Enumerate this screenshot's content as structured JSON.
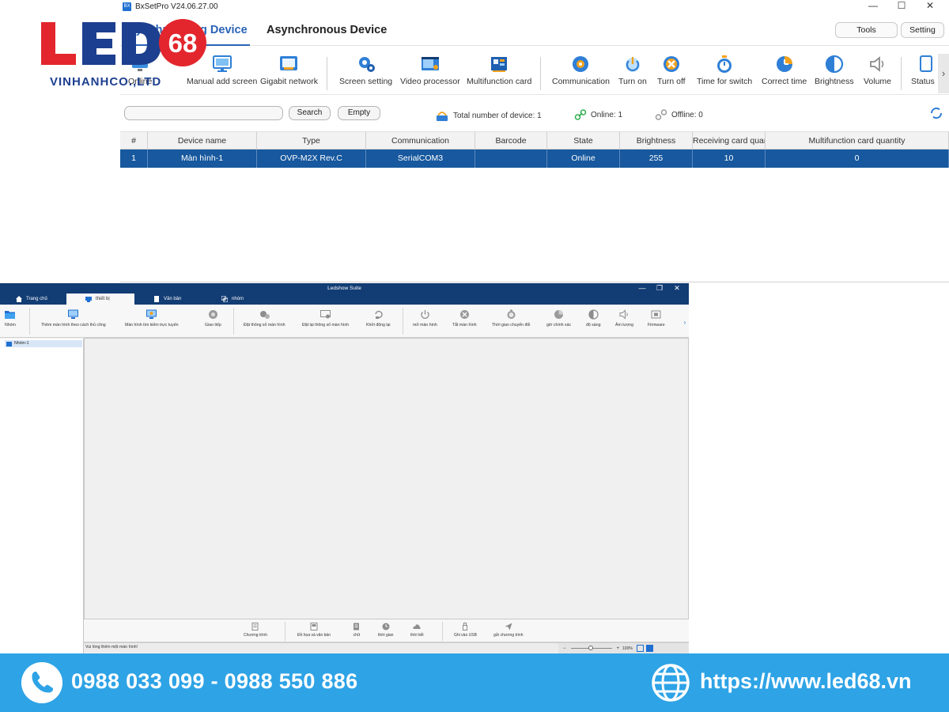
{
  "bxsetpro": {
    "window_title": "BxSetPro V24.06.27.00",
    "app_icon_text": "BX",
    "window_controls": [
      "—",
      "☐",
      "✕"
    ],
    "tabs": {
      "sync": "Synchronizing Device",
      "async": "Asynchronous Device"
    },
    "top_buttons": {
      "tools": "Tools",
      "setting": "Setting"
    },
    "toolbar": [
      {
        "label": "Online",
        "icon": "search-screen-icon"
      },
      {
        "label": "Manual add screen",
        "icon": "monitor-icon"
      },
      {
        "label": "Gigabit network",
        "icon": "network-card-icon"
      },
      {
        "label": "Screen setting",
        "icon": "gear-icon"
      },
      {
        "label": "Video processor",
        "icon": "video-processor-icon"
      },
      {
        "label": "Multifunction card",
        "icon": "circuit-card-icon"
      },
      {
        "label": "Communication",
        "icon": "communication-icon"
      },
      {
        "label": "Turn on",
        "icon": "power-icon"
      },
      {
        "label": "Turn off",
        "icon": "close-circle-icon"
      },
      {
        "label": "Time for switch",
        "icon": "timer-icon"
      },
      {
        "label": "Correct time",
        "icon": "clock-icon"
      },
      {
        "label": "Brightness",
        "icon": "brightness-icon"
      },
      {
        "label": "Volume",
        "icon": "volume-icon"
      },
      {
        "label": "Status",
        "icon": "status-icon"
      }
    ],
    "toolbar_more": "›",
    "search": {
      "value": "",
      "search_label": "Search",
      "empty_label": "Empty"
    },
    "stats": {
      "total": "Total number of device:  1",
      "online": "Online:  1",
      "offline": "Offline:  0"
    },
    "table": {
      "headers": [
        "#",
        "Device name",
        "Type",
        "Communication",
        "Barcode",
        "State",
        "Brightness",
        "Receiving card quantity",
        "Multifunction card quantity"
      ],
      "rows": [
        [
          "1",
          "Màn hình-1",
          "OVP-M2X Rev.C",
          "SerialCOM3",
          "",
          "Online",
          "255",
          "10",
          "0"
        ]
      ]
    }
  },
  "logo": {
    "brand": "LED68",
    "brand_left": "LED",
    "brand_right": "68",
    "subtitle": "VINHANHCO.,LTD",
    "colors": {
      "red": "#e3262d",
      "blue": "#1d3f8f"
    }
  },
  "ledshow": {
    "window_title": "Ledshow Suite",
    "window_controls": [
      "—",
      "❐",
      "✕"
    ],
    "tabs": [
      {
        "label": "Trang chủ",
        "icon": "home-icon"
      },
      {
        "label": "thiết bị",
        "icon": "device-icon"
      },
      {
        "label": "Văn bản",
        "icon": "document-icon"
      },
      {
        "label": "nhóm",
        "icon": "group-icon"
      }
    ],
    "ribbon": [
      {
        "label": "Nhóm",
        "icon": "folder-icon"
      },
      {
        "label": "Thêm màn hình theo cách thủ công",
        "icon": "monitor-add-icon"
      },
      {
        "label": "Màn hình tìm kiếm trực tuyến",
        "icon": "monitor-search-icon"
      },
      {
        "label": "Giao tiếp",
        "icon": "communication-icon"
      },
      {
        "label": "Đặt thông số màn hình",
        "icon": "screen-params-icon"
      },
      {
        "label": "Đặt lại thông số màn hình",
        "icon": "reset-params-icon"
      },
      {
        "label": "Khởi động lại",
        "icon": "restart-icon"
      },
      {
        "label": "mở màn hình",
        "icon": "power-icon"
      },
      {
        "label": "Tắt màn hình",
        "icon": "close-circle-icon"
      },
      {
        "label": "Thời gian chuyển đổi",
        "icon": "timer-icon"
      },
      {
        "label": "giờ chính xác",
        "icon": "clock-icon"
      },
      {
        "label": "độ sáng",
        "icon": "brightness-icon"
      },
      {
        "label": "Âm lượng",
        "icon": "volume-icon"
      },
      {
        "label": "Firmware",
        "icon": "firmware-icon"
      }
    ],
    "ribbon_more": "›",
    "tree": {
      "group_item": "Nhóm-1"
    },
    "bottom_bar": [
      {
        "label": "Chương trình",
        "icon": "program-icon"
      },
      {
        "label": "Đồ họa và văn bản",
        "icon": "graphic-text-icon"
      },
      {
        "label": "chữ",
        "icon": "text-icon"
      },
      {
        "label": "thời gian",
        "icon": "clock-icon"
      },
      {
        "label": "thời tiết",
        "icon": "weather-icon"
      },
      {
        "label": "Ghi vào USB",
        "icon": "usb-icon"
      },
      {
        "label": "gửi chương trình",
        "icon": "send-icon"
      }
    ],
    "status_text": "Vui lòng thêm một màn hình!",
    "zoom": {
      "minus": "−",
      "plus": "+",
      "level": "100%"
    }
  },
  "banner": {
    "phones": "0988 033 099 - 0988 550 886",
    "url": "https://www.led68.vn",
    "color": "#2ea3e6"
  }
}
